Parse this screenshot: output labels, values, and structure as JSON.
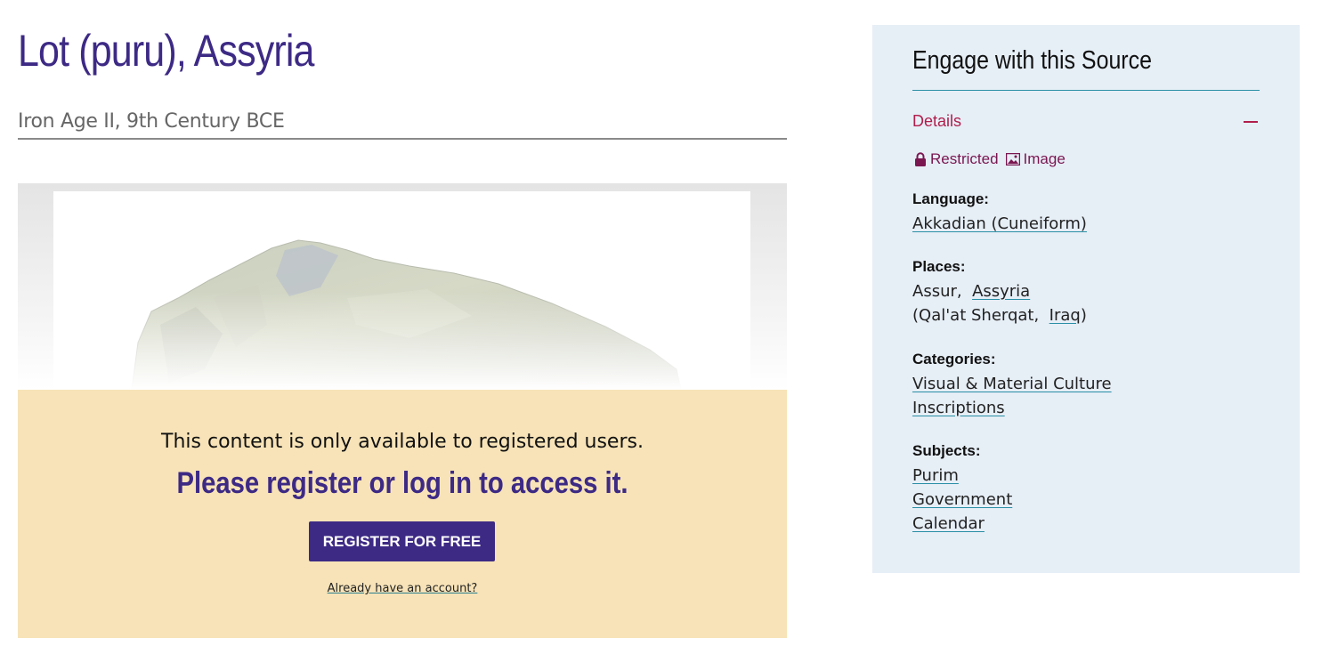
{
  "page": {
    "title": "Lot (puru), Assyria",
    "subtitle": "Iron Age II, 9th Century BCE"
  },
  "gate": {
    "message": "This content is only available to registered users.",
    "cta": "Please register or log in to access it.",
    "register_label": "REGISTER FOR FREE",
    "login_link": "Already have an account?"
  },
  "sidebar": {
    "heading": "Engage with this Source",
    "details_label": "Details",
    "badges": [
      {
        "label": "Restricted",
        "icon": "lock-icon"
      },
      {
        "label": "Image",
        "icon": "image-icon"
      }
    ],
    "language": {
      "label": "Language:",
      "value": "Akkadian (Cuneiform)"
    },
    "places": {
      "label": "Places:",
      "line1_plain": "Assur,",
      "line1_link": "Assyria",
      "line2_open": "(Qal'at Sherqat,",
      "line2_link": "Iraq",
      "line2_close": ")"
    },
    "categories": {
      "label": "Categories:",
      "items": [
        "Visual & Material Culture",
        "Inscriptions"
      ]
    },
    "subjects": {
      "label": "Subjects:",
      "items": [
        "Purim",
        "Government",
        "Calendar"
      ]
    }
  },
  "colors": {
    "brand_purple": "#3d2a85",
    "accent_crimson": "#b01e4c",
    "gate_background": "#f7e3b7",
    "sidebar_background": "#e6eef6"
  }
}
